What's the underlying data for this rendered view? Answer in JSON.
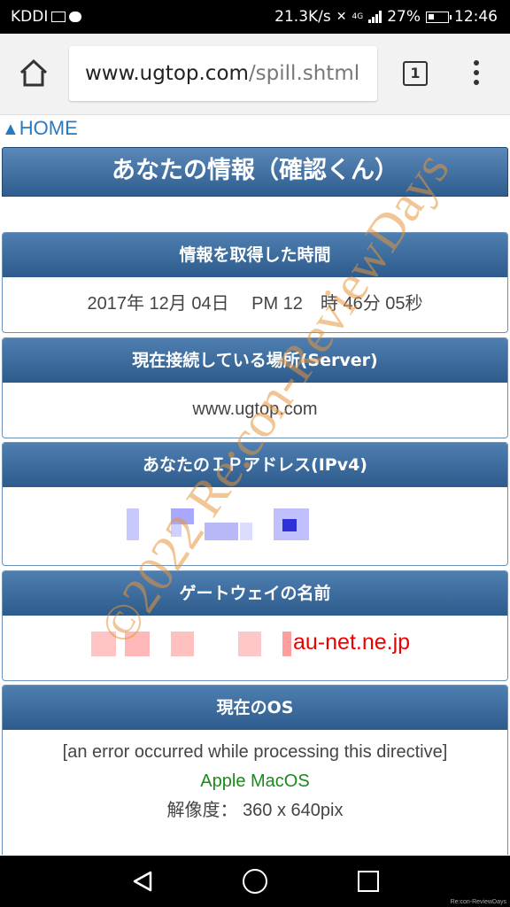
{
  "status_bar": {
    "carrier": "KDDI",
    "net_speed": "21.3K/s",
    "network": "4G",
    "battery": "27%",
    "time": "12:46"
  },
  "browser": {
    "url_host": "www.ugtop.com",
    "url_path": "/spill.shtml",
    "tab_count": "1"
  },
  "page": {
    "home_link": "HOME",
    "title": "あなたの情報（確認くん）",
    "sections": {
      "time": {
        "heading": "情報を取得した時間",
        "value": "2017年 12月 04日　 PM 12　時 46分 05秒"
      },
      "server": {
        "heading": "現在接続している場所(Server)",
        "value": "www.ugtop.com"
      },
      "ip": {
        "heading": "あなたのＩＰアドレス(IPv4)"
      },
      "gateway": {
        "heading": "ゲートウェイの名前",
        "value_suffix": "au-net.ne.jp"
      },
      "os": {
        "heading": "現在のOS",
        "error": "[an error occurred while processing this directive]",
        "os_name": "Apple MacOS",
        "resolution_label": "解像度：",
        "resolution_value": "360 x 640pix"
      }
    },
    "watermark": "©2022 Re:con-ReviewDays",
    "footer_mark": "Re:con-ReviewDays"
  },
  "colors": {
    "link": "#2a7ac0",
    "header": "#2e5d8f",
    "gateway_text": "#ee0000",
    "os_text": "#1a8a1a",
    "watermark": "#e6963c"
  }
}
